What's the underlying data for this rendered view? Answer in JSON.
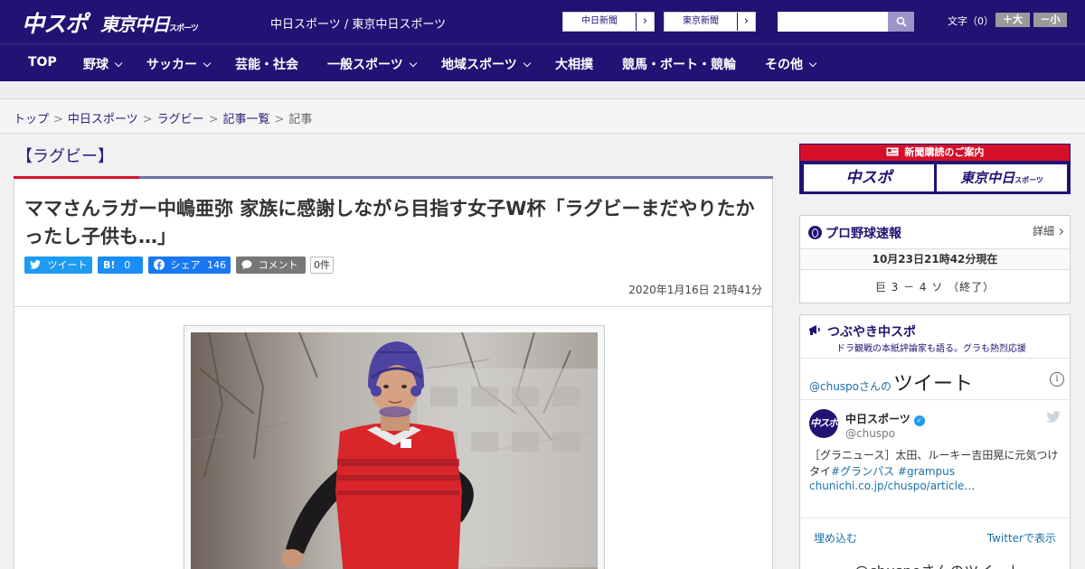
{
  "header": {
    "logo_chuspo": "中スポ",
    "logo_tokyo": "東京中日",
    "logo_tokyo_small": "スポーツ",
    "site_name": "中日スポーツ / 東京中日スポーツ",
    "ext_links": [
      {
        "label": "中日新聞"
      },
      {
        "label": "東京新聞"
      }
    ],
    "search": {
      "placeholder": "",
      "value": ""
    },
    "font_size": {
      "label": "文字（0）",
      "increase": "＋大",
      "decrease": "－小"
    }
  },
  "nav": {
    "items": [
      {
        "label": "TOP"
      },
      {
        "label": "野球"
      },
      {
        "label": "サッカー"
      },
      {
        "label": "芸能・社会"
      },
      {
        "label": "一般スポーツ"
      },
      {
        "label": "地域スポーツ"
      },
      {
        "label": "大相撲"
      },
      {
        "label": "競馬・ボート・競輪"
      },
      {
        "label": "その他"
      }
    ]
  },
  "breadcrumb": {
    "items": [
      "トップ",
      "中日スポーツ",
      "ラグビー",
      "記事一覧"
    ],
    "separator": ">",
    "current": "記事"
  },
  "article": {
    "category": "【ラグビー】",
    "headline": "ママさんラガー中嶋亜弥 家族に感謝しながら目指す女子W杯「ラグビーまだやりたかったし子供も…」",
    "share": {
      "tweet": "ツイート",
      "hatena_label": "B!",
      "hatena_count": "0",
      "facebook": "シェア",
      "facebook_count": "146",
      "comment": "コメント",
      "comment_count": "0件"
    },
    "date": "2020年1月16日 21時41分"
  },
  "sidebar": {
    "subscribe": {
      "bar": "新聞購読のご案内",
      "chuspo": "中スポ",
      "tokyo": "東京中日",
      "tokyo_small": "スポーツ"
    },
    "baseball": {
      "title": "プロ野球速報",
      "details": "詳細",
      "date": "10月23日21時42分現在",
      "score": "巨 3 － 4 ソ （終了）"
    },
    "twitter": {
      "title": "つぶやき中スポ",
      "subtitle": "ドラ観戦の本紙評論家も語る。グラも熱烈応援",
      "embed_prefix": "@chuspoさんの",
      "embed_title": "ツイート",
      "info": "i",
      "avatar_text": "中スポ",
      "name": "中日スポーツ",
      "handle": "@chuspo",
      "tweet_text": "［グラニュース］太田、ルーキー吉田晃に元気つけ",
      "tweet_text2": "タイ",
      "hashtag1": "#グランパス",
      "hashtag2": "#grampus",
      "link": "chunichi.co.jp/chuspo/article…",
      "embed_link": "埋め込む",
      "view_link": "Twitterで表示",
      "more": "@chuspoさんのツイート"
    }
  },
  "colors": {
    "brand_navy": "#201374",
    "accent_red": "#d3122c",
    "twitter_blue": "#1d9bf0",
    "facebook_blue": "#1877f2"
  }
}
